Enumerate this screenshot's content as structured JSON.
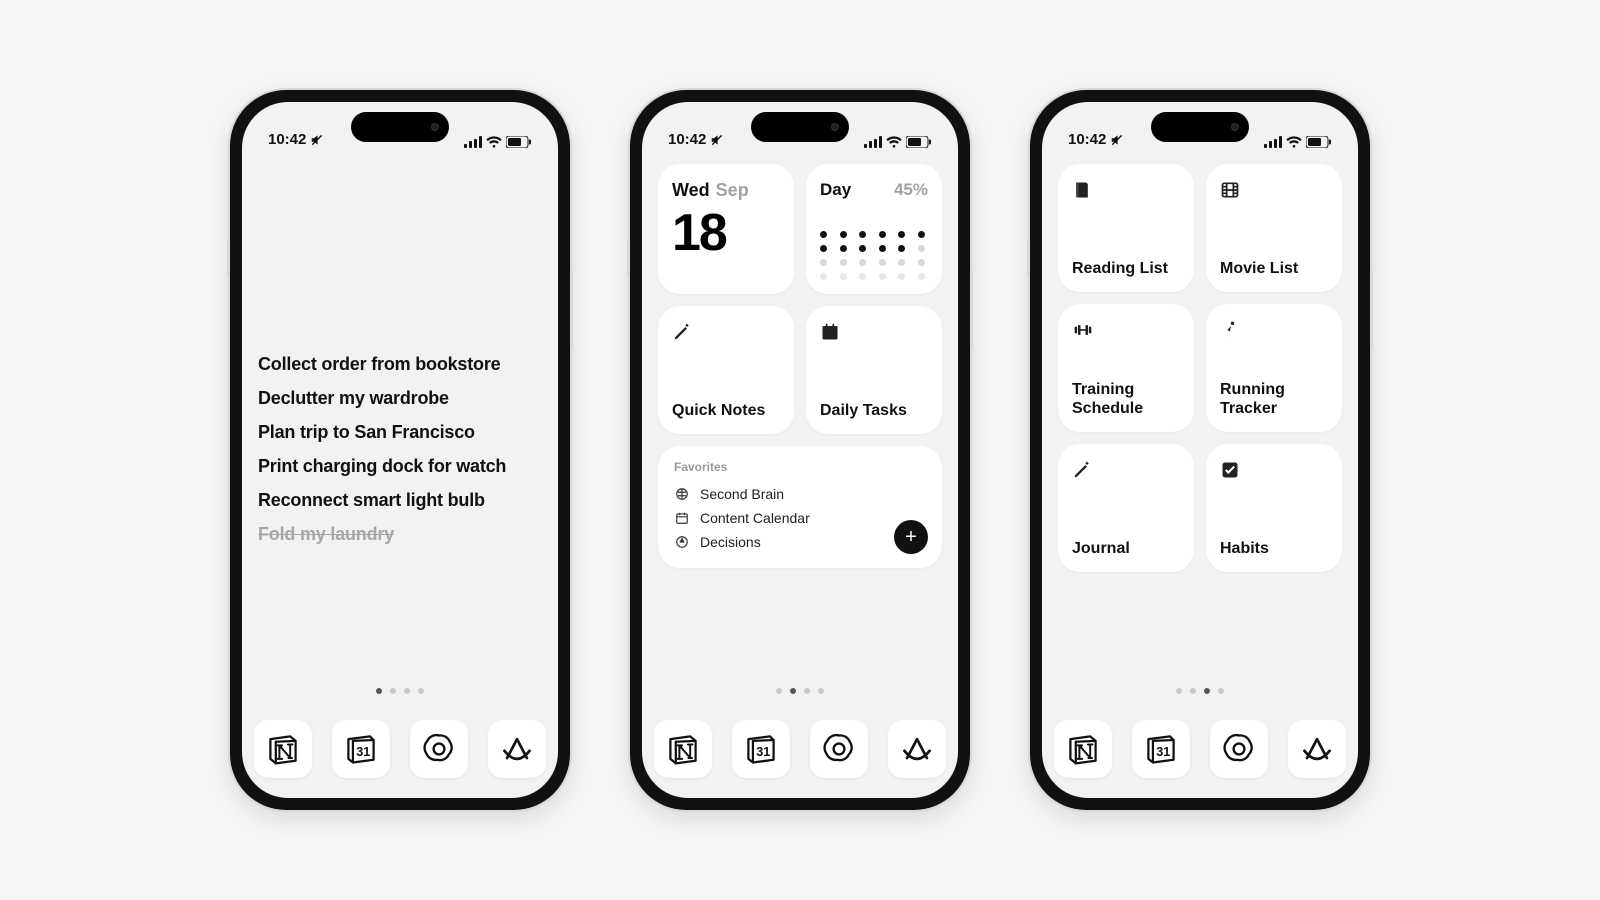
{
  "status": {
    "time": "10:42"
  },
  "screen1": {
    "tasks": [
      {
        "text": "Collect order from bookstore",
        "done": false
      },
      {
        "text": "Declutter my wardrobe",
        "done": false
      },
      {
        "text": "Plan trip to San Francisco",
        "done": false
      },
      {
        "text": "Print charging dock for watch",
        "done": false
      },
      {
        "text": "Reconnect smart light bulb",
        "done": false
      },
      {
        "text": "Fold my laundry",
        "done": true
      }
    ],
    "page_count": 4,
    "active_page": 0
  },
  "screen2": {
    "calendar": {
      "dow": "Wed",
      "month": "Sep",
      "day": "18"
    },
    "day_progress": {
      "label": "Day",
      "percent": "45%",
      "filled": 11,
      "total": 24
    },
    "widgets": [
      {
        "icon": "pencil",
        "label": "Quick Notes"
      },
      {
        "icon": "calendar",
        "label": "Daily Tasks"
      }
    ],
    "favorites": {
      "title": "Favorites",
      "items": [
        {
          "icon": "brain",
          "label": "Second Brain"
        },
        {
          "icon": "schedule",
          "label": "Content Calendar"
        },
        {
          "icon": "nav",
          "label": "Decisions"
        }
      ]
    },
    "page_count": 4,
    "active_page": 1
  },
  "screen3": {
    "widgets": [
      {
        "icon": "book",
        "label": "Reading List"
      },
      {
        "icon": "film",
        "label": "Movie List"
      },
      {
        "icon": "dumbbell",
        "label": "Training Schedule"
      },
      {
        "icon": "runner",
        "label": "Running Tracker"
      },
      {
        "icon": "pencil",
        "label": "Journal"
      },
      {
        "icon": "check",
        "label": "Habits"
      }
    ],
    "page_count": 4,
    "active_page": 2
  },
  "dock": [
    {
      "name": "notion"
    },
    {
      "name": "calendar31"
    },
    {
      "name": "openai"
    },
    {
      "name": "arc"
    }
  ]
}
